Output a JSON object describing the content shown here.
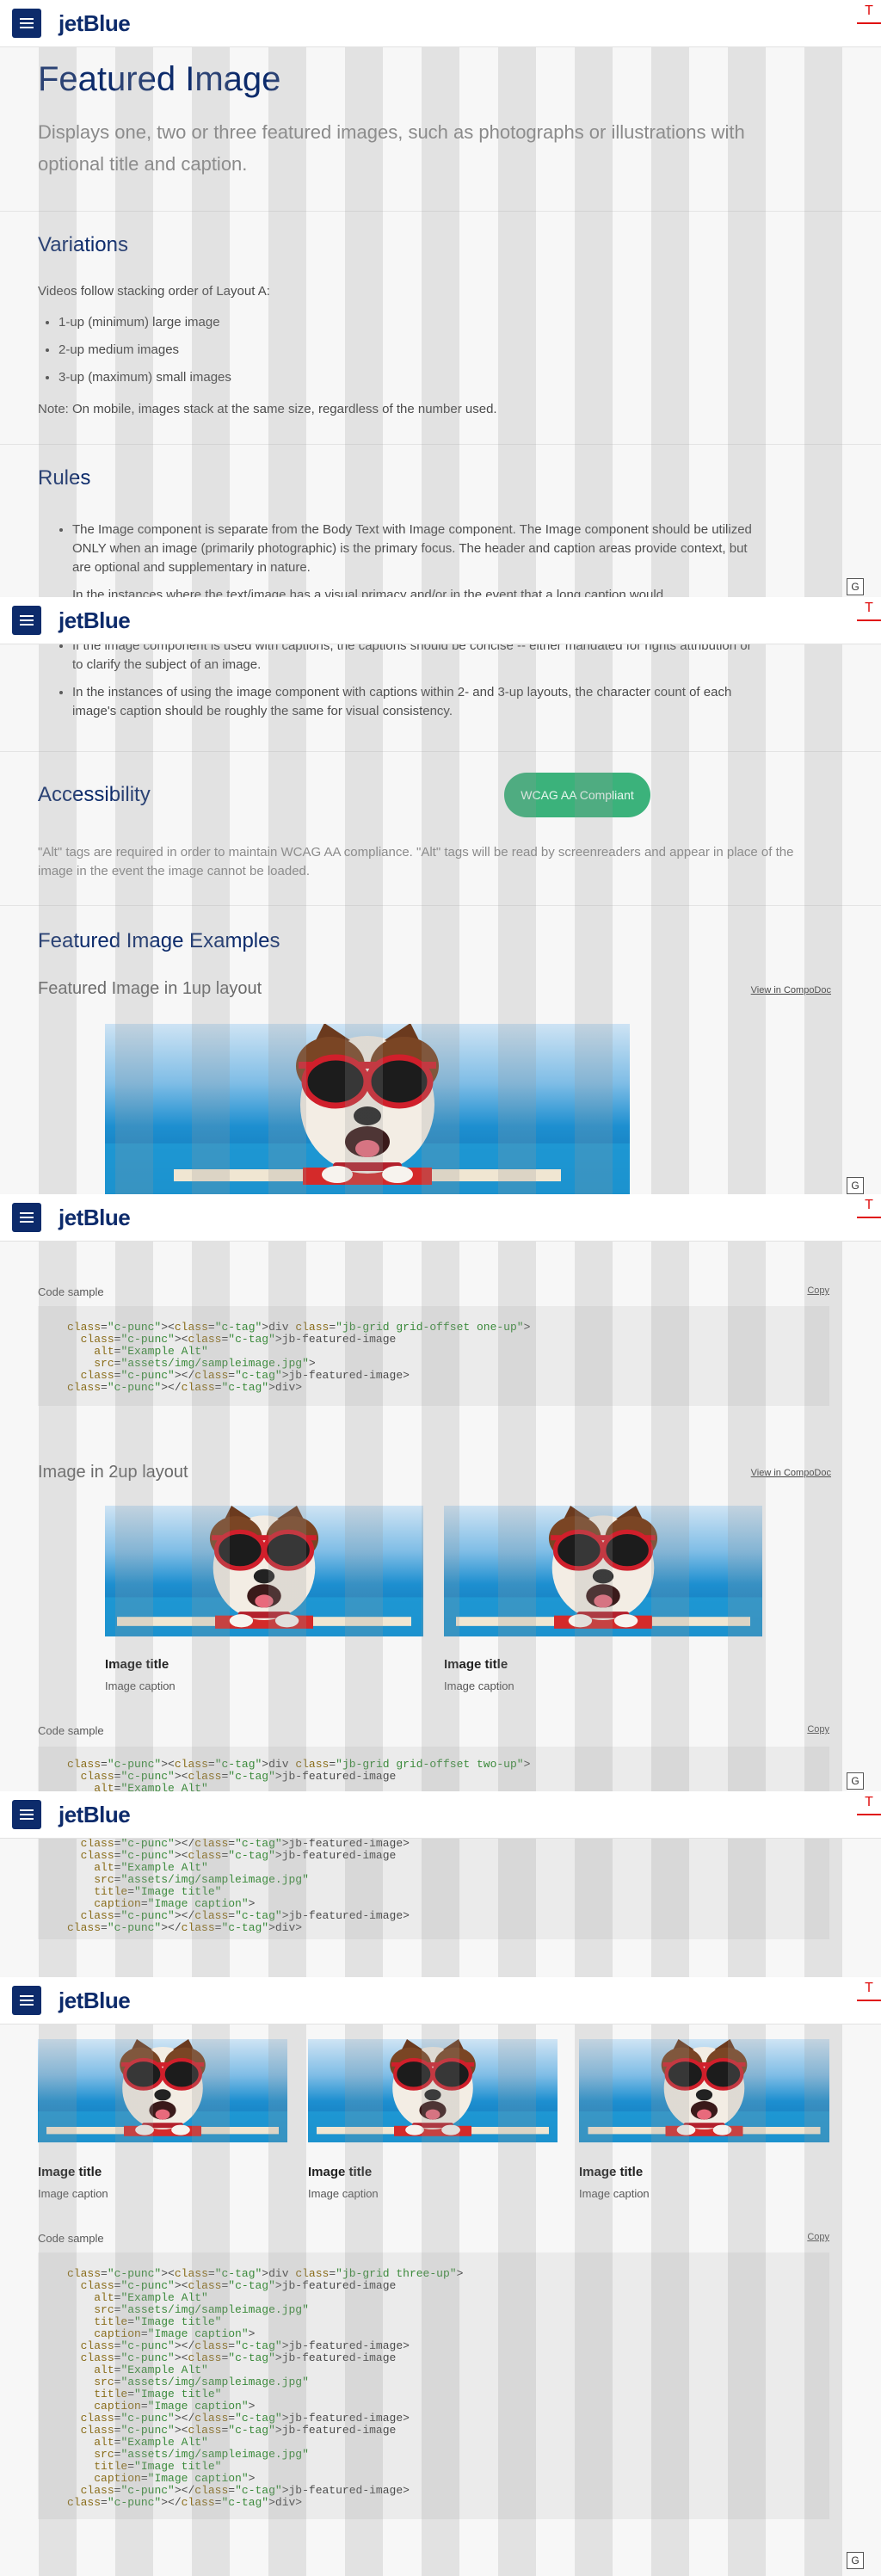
{
  "brand": {
    "logo_text": "jetBlue",
    "header_color": "#0d2b6b",
    "accent_green": "#3bb27b"
  },
  "side_tabs": {
    "t_label": "T",
    "g_label": "G"
  },
  "page": {
    "title": "Featured Image",
    "description": "Displays one, two or three featured images, such as photographs or illustrations with optional title and caption."
  },
  "variations": {
    "heading": "Variations",
    "intro": "Videos follow stacking order of Layout A:",
    "items": [
      "1-up (minimum) large image",
      "2-up medium images",
      "3-up (maximum) small images"
    ],
    "note": "Note: On mobile, images stack at the same size, regardless of the number used."
  },
  "rules": {
    "heading": "Rules",
    "items": [
      "The Image component is separate from the Body Text with Image component. The Image component should be utilized ONLY when an image (primarily photographic) is the primary focus. The header and caption areas provide context, but are optional and supplementary in nature.",
      "In the instances where the text/image has a visual primacy and/or in the event that a long caption would",
      "If the image component is used with captions, the captions should be concise -- either mandated for rights attribution or to clarify the subject of an image.",
      "In the instances of using the image component with captions within 2- and 3-up layouts, the character count of each image's caption should be roughly the same for visual consistency."
    ]
  },
  "accessibility": {
    "heading": "Accessibility",
    "badge": "WCAG AA Compliant",
    "text": "\"Alt\" tags are required in order to maintain WCAG AA compliance. \"Alt\" tags will be read by screenreaders and appear in place of the image in the event the image cannot be loaded."
  },
  "examples": {
    "heading": "Featured Image Examples",
    "one_up": {
      "title": "Featured Image in 1up layout",
      "link": "View in CompoDoc"
    },
    "two_up": {
      "title": "Image in 2up layout",
      "link": "View in CompoDoc"
    },
    "code_label": "Code sample",
    "copy_label": "Copy",
    "image_title": "Image title",
    "image_caption": "Image caption"
  },
  "code": {
    "one_up": [
      "<div class=\"jb-grid grid-offset one-up\">",
      "  <jb-featured-image",
      "    alt=\"Example Alt\"",
      "    src=\"assets/img/sampleimage.jpg\">",
      "  </jb-featured-image>",
      "</div>"
    ],
    "two_up_top": [
      "<div class=\"jb-grid grid-offset two-up\">",
      "  <jb-featured-image",
      "    alt=\"Example Alt\""
    ],
    "two_up_bottom": [
      "  </jb-featured-image>",
      "  <jb-featured-image",
      "    alt=\"Example Alt\"",
      "    src=\"assets/img/sampleimage.jpg\"",
      "    title=\"Image title\"",
      "    caption=\"Image caption\">",
      "  </jb-featured-image>",
      "</div>"
    ],
    "three_up": [
      "<div class=\"jb-grid three-up\">",
      "  <jb-featured-image",
      "    alt=\"Example Alt\"",
      "    src=\"assets/img/sampleimage.jpg\"",
      "    title=\"Image title\"",
      "    caption=\"Image caption\">",
      "  </jb-featured-image>",
      "  <jb-featured-image",
      "    alt=\"Example Alt\"",
      "    src=\"assets/img/sampleimage.jpg\"",
      "    title=\"Image title\"",
      "    caption=\"Image caption\">",
      "  </jb-featured-image>",
      "  <jb-featured-image",
      "    alt=\"Example Alt\"",
      "    src=\"assets/img/sampleimage.jpg\"",
      "    title=\"Image title\"",
      "    caption=\"Image caption\">",
      "  </jb-featured-image>",
      "</div>"
    ]
  }
}
